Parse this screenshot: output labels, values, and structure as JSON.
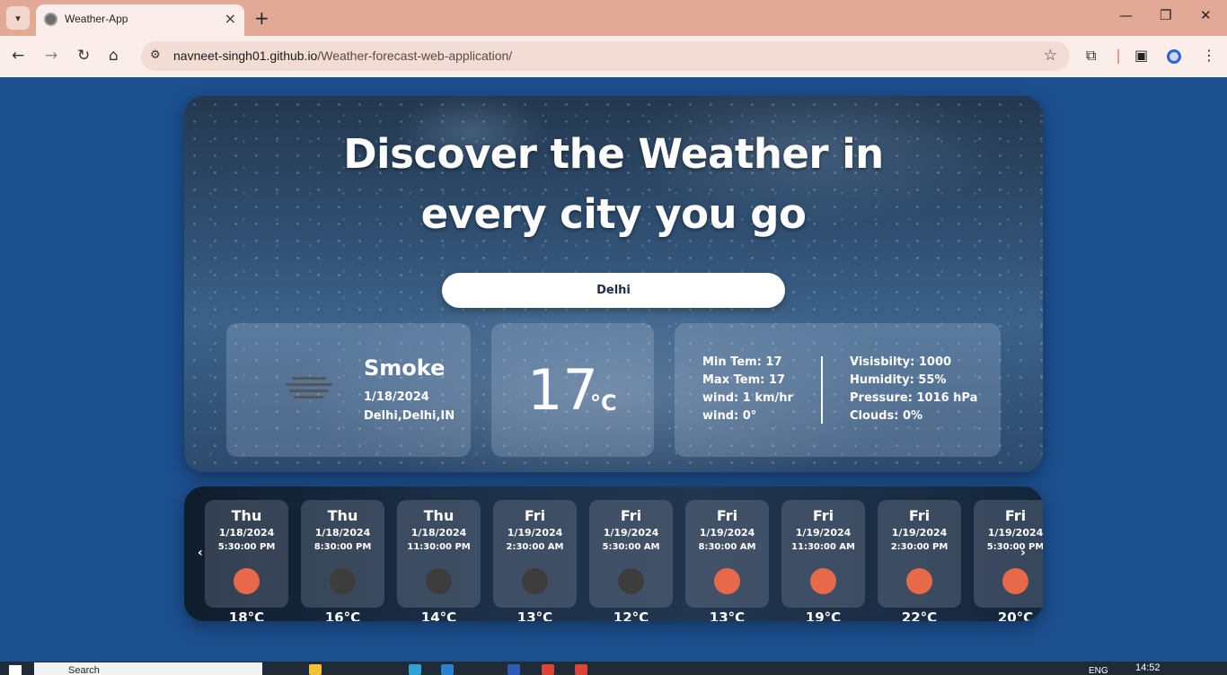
{
  "browser": {
    "tab_title": "Weather-App",
    "url_host": "navneet-singh01.github.io",
    "url_path": "/Weather-forecast-web-application/"
  },
  "hero": {
    "title_line1": "Discover the Weather in",
    "title_line2": "every city you go",
    "search_value": "Delhi"
  },
  "current": {
    "condition": "Smoke",
    "date": "1/18/2024",
    "location": "Delhi,Delhi,IN",
    "temp": "17",
    "unit": "°C",
    "min_temp": "Min Tem: 17",
    "max_temp": "Max Tem: 17",
    "wind_speed": "wind: 1 km/hr",
    "wind_deg": "wind: 0°",
    "visibility": "Visisbilty: 1000",
    "humidity": "Humidity: 55%",
    "pressure": "Pressure: 1016 hPa",
    "clouds": "Clouds: 0%"
  },
  "forecast": [
    {
      "day": "Thu",
      "date": "1/18/2024",
      "time": "5:30:00 PM",
      "temp": "18°C",
      "icon": "sun-icon"
    },
    {
      "day": "Thu",
      "date": "1/18/2024",
      "time": "8:30:00 PM",
      "temp": "16°C",
      "icon": "moon-icon"
    },
    {
      "day": "Thu",
      "date": "1/18/2024",
      "time": "11:30:00 PM",
      "temp": "14°C",
      "icon": "moon-icon"
    },
    {
      "day": "Fri",
      "date": "1/19/2024",
      "time": "2:30:00 AM",
      "temp": "13°C",
      "icon": "moon-icon"
    },
    {
      "day": "Fri",
      "date": "1/19/2024",
      "time": "5:30:00 AM",
      "temp": "12°C",
      "icon": "moon-icon"
    },
    {
      "day": "Fri",
      "date": "1/19/2024",
      "time": "8:30:00 AM",
      "temp": "13°C",
      "icon": "sun-icon"
    },
    {
      "day": "Fri",
      "date": "1/19/2024",
      "time": "11:30:00 AM",
      "temp": "19°C",
      "icon": "sun-icon"
    },
    {
      "day": "Fri",
      "date": "1/19/2024",
      "time": "2:30:00 PM",
      "temp": "22°C",
      "icon": "sun-icon"
    },
    {
      "day": "Fri",
      "date": "1/19/2024",
      "time": "5:30:00 PM",
      "temp": "20°C",
      "icon": "sun-icon"
    }
  ],
  "colors": {
    "page_bg": "#1c4f8e",
    "sun": "#e8694a",
    "moon": "#3d3d3d"
  },
  "taskbar": {
    "search_placeholder": "Search",
    "lang": "ENG",
    "time": "14:52"
  }
}
